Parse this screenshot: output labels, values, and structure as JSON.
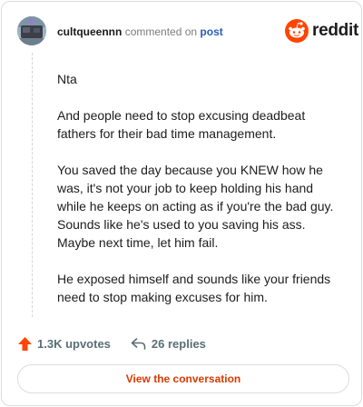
{
  "header": {
    "username": "cultqueennn",
    "action_text": "commented on",
    "post_link": "post",
    "brand_word": "reddit"
  },
  "comment": {
    "paragraphs": [
      "Nta",
      "And people need to stop excusing deadbeat fathers for their bad time management.",
      "You saved the day because you KNEW how he was, it's not your job to keep holding his hand while he keeps on acting as if you're the bad guy. Sounds like he's used to you saving his ass. Maybe next time, let him fail.",
      "He exposed himself and sounds like your friends need to stop making excuses for him."
    ]
  },
  "footer": {
    "upvotes": "1.3K upvotes",
    "replies": "26 replies",
    "cta_label": "View the conversation"
  },
  "icons": {
    "upvote": "upvote-arrow-icon",
    "reply": "reply-arrow-icon",
    "brand": "reddit-snoo-icon"
  },
  "colors": {
    "accent": "#d93a00",
    "upvote": "#ff4500",
    "link": "#2a5db0",
    "muted": "#576f76"
  }
}
